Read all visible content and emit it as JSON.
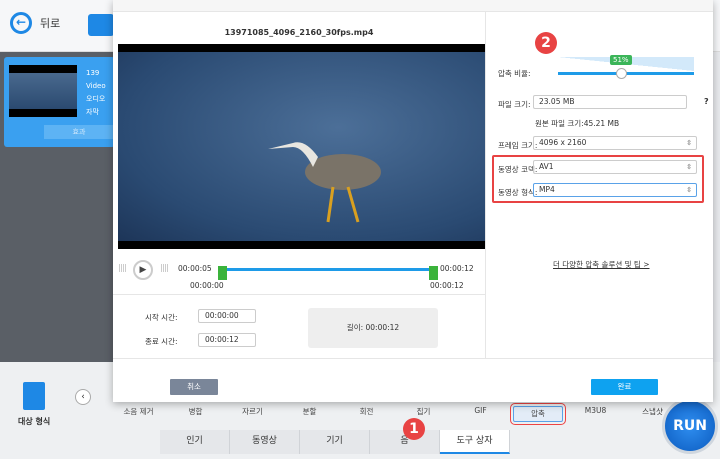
{
  "topbar": {
    "back_label": "뒤로"
  },
  "file_card": {
    "name": "13971085_4096_2160_30fps.mp4",
    "name_visible": "139",
    "video": "Video",
    "audio": "오디오",
    "subtitle": "자막",
    "effect_label": "효과"
  },
  "bottom": {
    "target_format": "대상 형식",
    "tools": [
      "소음 제거",
      "병합",
      "자르기",
      "분할",
      "회전",
      "집기",
      "GIF",
      "압축",
      "M3U8",
      "스냅샷"
    ],
    "tabs": [
      "인기",
      "동영상",
      "기기",
      "음",
      "도구 상자"
    ],
    "run_label": "RUN"
  },
  "badges": {
    "one": "1",
    "two": "2"
  },
  "dialog": {
    "filename": "13971085_4096_2160_30fps.mp4",
    "player": {
      "current": "00:00:05",
      "start_marker": "00:00:00",
      "end_top": "00:00:12",
      "end_bottom": "00:00:12"
    },
    "start_label": "시작 시간:",
    "start_value": "00:00:00",
    "end_label": "종료 시간:",
    "end_value": "00:00:12",
    "duration": "길이: 00:00:12",
    "compress_label": "압축 비율:",
    "compress_percent": "51%",
    "compress_value": 51,
    "filesize_label": "파일 크기:",
    "filesize_value": "23.05  MB",
    "help": "?",
    "original_size": "원본 파일 크기:45.21 MB",
    "frame_label": "프레임 크기:",
    "frame_value": "4096 x 2160",
    "codec_label": "동영상 코덱:",
    "codec_value": "AV1",
    "format_label": "동영상 형식:",
    "format_value": "MP4",
    "more_link": "더 다양한 압축 솔루션 및 팁 >",
    "cancel": "취소",
    "ok": "완료"
  },
  "colors": {
    "accent": "#1e88e5",
    "highlight": "#e84343",
    "ok": "#0ea2f0"
  }
}
